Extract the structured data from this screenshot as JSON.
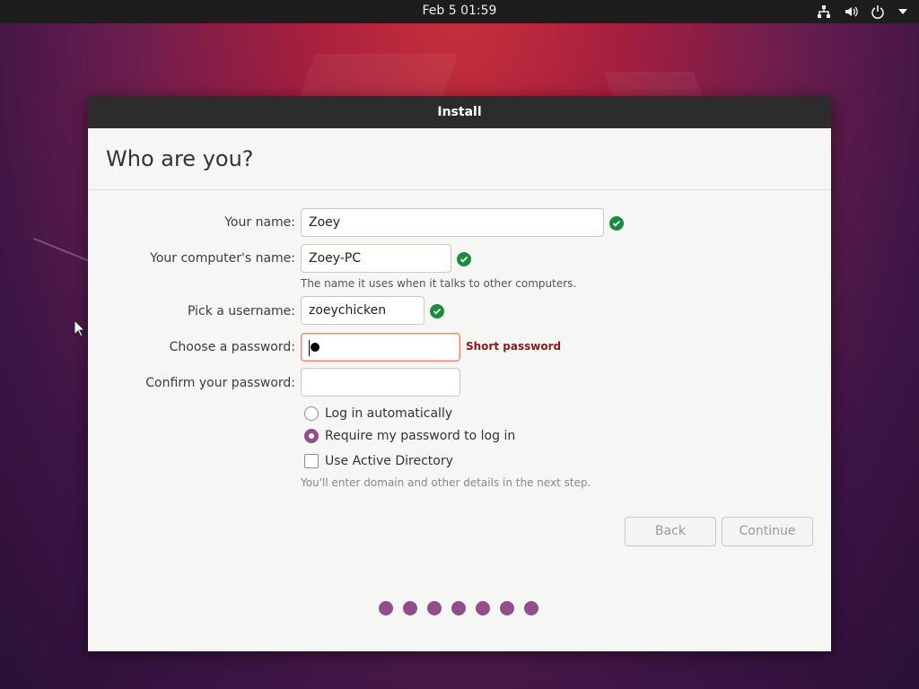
{
  "topbar": {
    "clock": "Feb 5  01:59",
    "icons": [
      "network-icon",
      "volume-icon",
      "power-icon",
      "chevron-down-icon"
    ]
  },
  "window": {
    "title": "Install",
    "heading": "Who are you?"
  },
  "form": {
    "name_label": "Your name:",
    "name_value": "Zoey",
    "computer_label": "Your computer's name:",
    "computer_value": "Zoey-PC",
    "computer_hint": "The name it uses when it talks to other computers.",
    "username_label": "Pick a username:",
    "username_value": "zoeychicken",
    "password_label": "Choose a password:",
    "password_status": "Short password",
    "confirm_label": "Confirm your password:",
    "confirm_value": "",
    "login_auto_label": "Log in automatically",
    "login_auto_selected": false,
    "require_password_label": "Require my password to log in",
    "require_password_selected": true,
    "active_directory_label": "Use Active Directory",
    "active_directory_checked": false,
    "active_directory_hint": "You'll enter domain and other details in the next step."
  },
  "buttons": {
    "back": "Back",
    "continue": "Continue"
  },
  "progress": {
    "steps": 7
  },
  "colors": {
    "accent": "#924d8b",
    "valid": "#1b8b3e",
    "error_text": "#8b1a1a",
    "titlebar": "#2c2c2c"
  }
}
